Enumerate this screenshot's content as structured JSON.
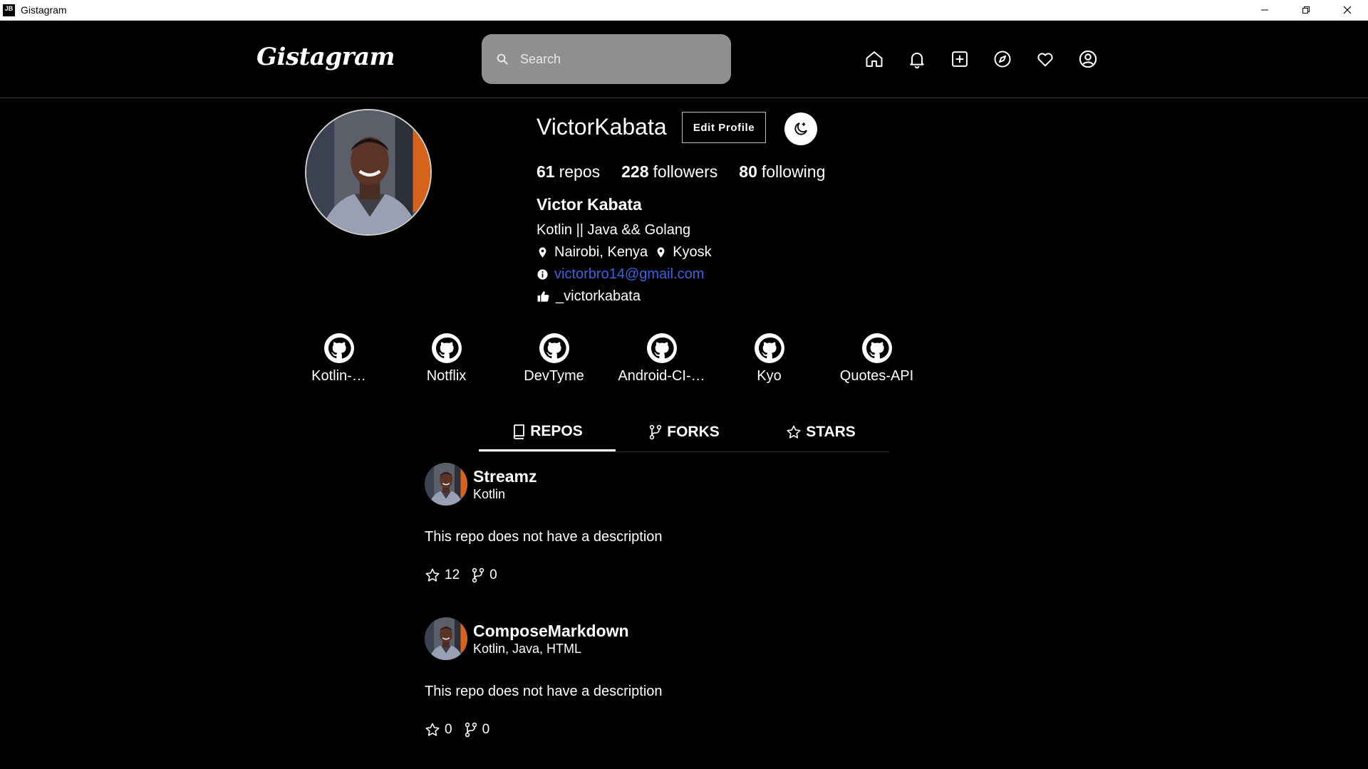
{
  "window": {
    "title": "Gistagram",
    "icon_text": "JB"
  },
  "header": {
    "logo": "Gistagram",
    "search_placeholder": "Search",
    "nav_icons": [
      "home-icon",
      "bell-icon",
      "plus-square-icon",
      "compass-icon",
      "heart-icon",
      "account-icon"
    ]
  },
  "profile": {
    "username": "VictorKabata",
    "edit_label": "Edit Profile",
    "stats": {
      "repos_count": "61",
      "repos_label": "repos",
      "followers_count": "228",
      "followers_label": "followers",
      "following_count": "80",
      "following_label": "following"
    },
    "full_name": "Victor Kabata",
    "bio": "Kotlin || Java && Golang",
    "location": "Nairobi, Kenya",
    "company": "Kyosk",
    "email": "victorbro14@gmail.com",
    "twitter": "_victorkabata"
  },
  "highlights": [
    {
      "label": "Kotlin-…"
    },
    {
      "label": "Notflix"
    },
    {
      "label": "DevTyme"
    },
    {
      "label": "Android-CI-…"
    },
    {
      "label": "Kyo"
    },
    {
      "label": "Quotes-API"
    }
  ],
  "tabs": [
    {
      "label": "REPOS",
      "active": true
    },
    {
      "label": "FORKS",
      "active": false
    },
    {
      "label": "STARS",
      "active": false
    }
  ],
  "repos": [
    {
      "name": "Streamz",
      "languages": "Kotlin",
      "description": "This repo does not have a description",
      "stars": "12",
      "forks": "0"
    },
    {
      "name": "ComposeMarkdown",
      "languages": "Kotlin, Java, HTML",
      "description": "This repo does not have a description",
      "stars": "0",
      "forks": "0"
    }
  ],
  "colors": {
    "background": "#000000",
    "search_bg": "#8f8f8f",
    "link": "#3a63e0"
  }
}
